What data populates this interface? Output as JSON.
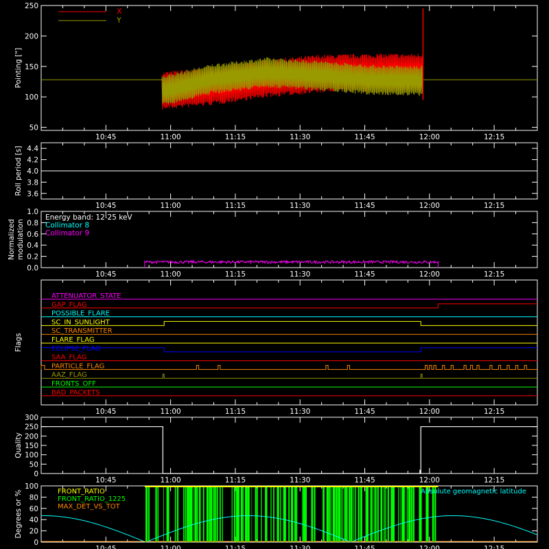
{
  "time_axis": {
    "ticks": [
      "10:45",
      "11:00",
      "11:15",
      "11:30",
      "11:45",
      "12:00",
      "12:15"
    ],
    "tick_minutes_from_1030": [
      15,
      30,
      45,
      60,
      75,
      90,
      105
    ],
    "range_minutes_from_1030": [
      0,
      115
    ]
  },
  "colors": {
    "background": "#000000",
    "axes": "#ffffff",
    "red": "#ff0000",
    "olive": "#999900",
    "cyan": "#00ffff",
    "magenta": "#ff00ff",
    "green": "#00ff00",
    "orange": "#ff8800",
    "yellow": "#ffff00",
    "blue": "#0000ff"
  },
  "chart_data": [
    {
      "type": "line",
      "ylabel": "Pointing [\"]",
      "ylim": [
        45,
        250
      ],
      "yticks": [
        50,
        100,
        150,
        200,
        250
      ],
      "legend": [
        {
          "name": "X",
          "color": "#ff0000"
        },
        {
          "name": "Y",
          "color": "#999900"
        }
      ],
      "baseline_value": 128,
      "series": [
        {
          "name": "X",
          "time_start_min": 28,
          "time_end_min": 88.5,
          "center": [
            110,
            118,
            130,
            138,
            140,
            140
          ],
          "amplitude": 30
        },
        {
          "name": "Y",
          "time_start_min": 28,
          "time_end_min": 88.5,
          "center": [
            110,
            130,
            140,
            135,
            128,
            126
          ],
          "amplitude": 28
        }
      ],
      "spike": {
        "time_min": 88.5,
        "max": 245,
        "min": 95
      }
    },
    {
      "type": "line",
      "ylabel": "Roll period [s]",
      "ylim": [
        3.5,
        4.5
      ],
      "yticks": [
        "3.6",
        "3.8",
        "4.0",
        "4.2",
        "4.4"
      ],
      "series": [
        {
          "name": "roll",
          "value": 4.0
        }
      ]
    },
    {
      "type": "line",
      "ylabel": "Normalized modulation",
      "ylim": [
        0,
        1.0
      ],
      "yticks": [
        "0.0",
        "0.2",
        "0.4",
        "0.6",
        "0.8",
        "1.0"
      ],
      "legend": [
        {
          "name": "Energy band: 12-25 keV",
          "color": "#ffffff"
        },
        {
          "name": "Collimator 8",
          "color": "#00ffff"
        },
        {
          "name": "Collimator 9",
          "color": "#ff00ff"
        }
      ],
      "series": [
        {
          "name": "Collimator 9",
          "time_start_min": 24,
          "time_end_min": 92,
          "mean": 0.1,
          "noise": 0.025
        }
      ]
    },
    {
      "type": "line",
      "ylabel": "Flags",
      "flags": [
        {
          "name": "ATTENUATOR_STATE",
          "color": "#ff00ff",
          "steps": [
            [
              0,
              0
            ]
          ]
        },
        {
          "name": "SAA_FLAG_GAP_FLAG",
          "label": "GAP_FLAG",
          "color": "#ff0000",
          "steps": [
            [
              0,
              0
            ],
            [
              92,
              1
            ]
          ]
        },
        {
          "name": "POSSIBLE_FLARE",
          "color": "#00ffff",
          "steps": [
            [
              0,
              0
            ]
          ]
        },
        {
          "name": "SC_IN_SUNLIGHT",
          "color": "#ffff00",
          "steps": [
            [
              0,
              0
            ],
            [
              28.5,
              1
            ],
            [
              88,
              0
            ]
          ]
        },
        {
          "name": "SC_TRANSMITTER",
          "color": "#ff8800",
          "steps": [
            [
              0,
              0
            ]
          ]
        },
        {
          "name": "FLARE_FLAG",
          "color": "#ffff00",
          "steps": [
            [
              0,
              0
            ]
          ]
        },
        {
          "name": "ECLIPSE_FLAG",
          "color": "#0000ff",
          "steps": [
            [
              0,
              1
            ],
            [
              28.5,
              0
            ],
            [
              88,
              1
            ]
          ]
        },
        {
          "name": "SAA_FLAG",
          "color": "#ff0000",
          "steps": [
            [
              0,
              0
            ]
          ]
        },
        {
          "name": "PARTICLE_FLAG",
          "color": "#ff8800",
          "pulses": [
            [
              0,
              0.8
            ],
            [
              36,
              36.5
            ],
            [
              41,
              41.5
            ],
            [
              66,
              66.5
            ],
            [
              71,
              71.5
            ],
            [
              89,
              89.5
            ],
            [
              90,
              90.5
            ],
            [
              91,
              91.5
            ],
            [
              93,
              93.5
            ],
            [
              95,
              95.5
            ],
            [
              98,
              98.5
            ],
            [
              99.5,
              100
            ],
            [
              101,
              101.5
            ],
            [
              104,
              104.5
            ],
            [
              106,
              106.5
            ],
            [
              108,
              108.5
            ],
            [
              110,
              110.5
            ],
            [
              112,
              112.5
            ]
          ]
        },
        {
          "name": "AAZ_FLAG",
          "color": "#999900",
          "pulses": [
            [
              28.2,
              28.5
            ],
            [
              88,
              88.3
            ]
          ]
        },
        {
          "name": "FRONTS_OFF",
          "color": "#00ff00",
          "steps": [
            [
              0,
              0
            ]
          ]
        },
        {
          "name": "BAD_PACKETS",
          "color": "#ff0000",
          "steps": [
            [
              0,
              0
            ]
          ]
        }
      ],
      "flag_labels": [
        "ATTENUATOR_STATE",
        "GAP_FLAG",
        "POSSIBLE_FLARE",
        "SC_IN_SUNLIGHT",
        "SC_TRANSMITTER",
        "FLARE_FLAG",
        "ECLIPSE_FLAG",
        "SAA_FLAG",
        "PARTICLE_FLAG",
        "AAZ_FLAG",
        "FRONTS_OFF",
        "BAD_PACKETS"
      ]
    },
    {
      "type": "line",
      "ylabel": "Quality",
      "ylim": [
        0,
        300
      ],
      "yticks": [
        "0",
        "50",
        "100",
        "150",
        "200",
        "250",
        "300"
      ],
      "series": [
        {
          "name": "quality",
          "steps": [
            [
              0,
              250
            ],
            [
              28.2,
              0
            ],
            [
              88,
              250
            ]
          ],
          "blip": {
            "time_min": 87.8,
            "max": 20
          }
        }
      ]
    },
    {
      "type": "line",
      "ylabel": "Degrees or %",
      "ylim": [
        0,
        100
      ],
      "yticks": [
        "0",
        "20",
        "40",
        "60",
        "80",
        "100"
      ],
      "legend": [
        {
          "name": "FRONT_RATIO",
          "color": "#ffff00"
        },
        {
          "name": "FRONT_RATIO_1225",
          "color": "#00ff00"
        },
        {
          "name": "MAX_DET_VS_TOT",
          "color": "#ff8800"
        },
        {
          "name": "Absolute geomagnetic latitude",
          "color": "#00ffff"
        }
      ],
      "latitude": {
        "amplitude": 47,
        "period_min": 47.5,
        "zero_at_min": 0.5
      },
      "green_bars": {
        "time_start_min": 24,
        "time_end_min": 92
      },
      "front_ratio": {
        "time_start_min": 24,
        "time_end_min": 92,
        "value": 100
      }
    }
  ]
}
